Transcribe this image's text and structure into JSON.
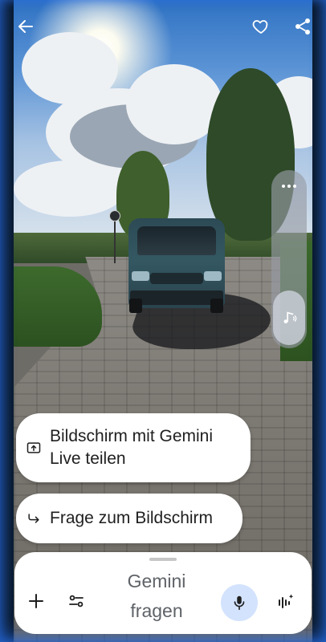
{
  "top_bar": {
    "back_icon": "arrow-left-icon",
    "favorite_icon": "heart-outline-icon",
    "share_icon": "share-icon"
  },
  "side_controls": {
    "more_icon": "more-horizontal-icon",
    "audio_icon": "music-note-icon"
  },
  "suggestions": [
    {
      "icon": "share-screen-icon",
      "label": "Bildschirm mit Gemini Live teilen"
    },
    {
      "icon": "redo-arrow-icon",
      "label": "Frage zum Bildschirm"
    }
  ],
  "input_panel": {
    "prompt_line1": "Gemini",
    "prompt_line2": "fragen",
    "add_icon": "plus-icon",
    "tools_icon": "tune-icon",
    "mic_icon": "mic-icon",
    "live_icon": "gemini-live-icon",
    "mic_bg_color": "#d3e3fd"
  }
}
